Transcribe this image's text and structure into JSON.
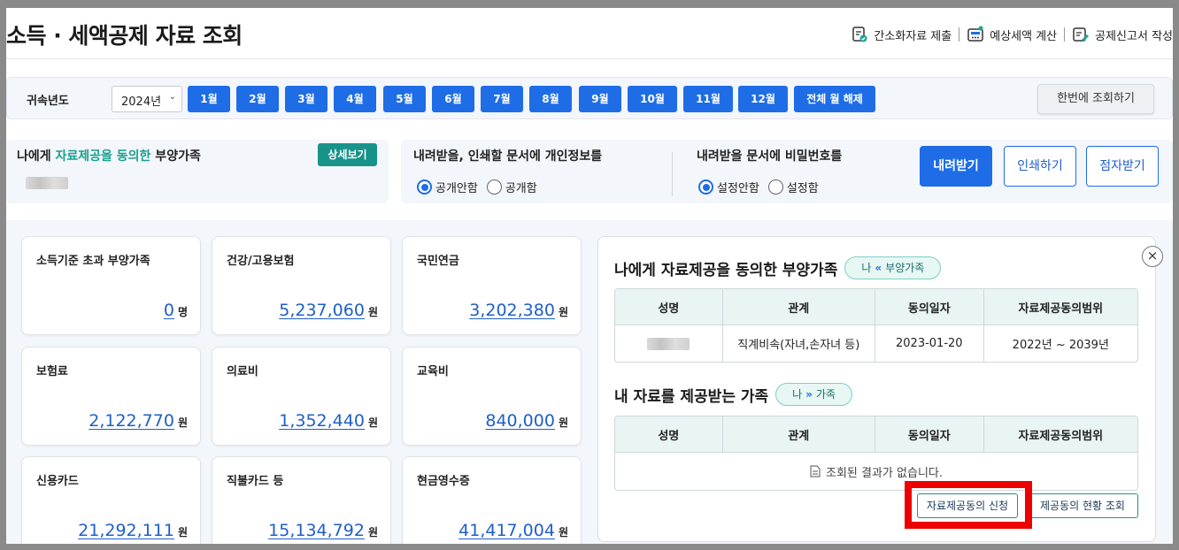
{
  "header": {
    "title": "소득 · 세액공제 자료 조회",
    "links": [
      {
        "label": "간소화자료 제출",
        "icon": "doc-check-icon"
      },
      {
        "label": "예상세액 계산",
        "icon": "calculator-icon"
      },
      {
        "label": "공제신고서 작성",
        "icon": "doc-edit-icon"
      }
    ]
  },
  "year_bar": {
    "label": "귀속년도",
    "year_value": "2024년",
    "months": [
      "1월",
      "2월",
      "3월",
      "4월",
      "5월",
      "6월",
      "7월",
      "8월",
      "9월",
      "10월",
      "11월",
      "12월"
    ],
    "clear_all": "전체 월 해제",
    "query_all": "한번에 조회하기"
  },
  "dependents": {
    "title_pre": "나에게 ",
    "title_hl": "자료제공을 동의한",
    "title_post": " 부양가족",
    "detail_button": "상세보기"
  },
  "options": {
    "personal_info": {
      "title": "내려받을, 인쇄할 문서에 개인정보를",
      "opt1": "공개안함",
      "opt2": "공개함",
      "selected": "공개안함"
    },
    "password": {
      "title": "내려받을 문서에 비밀번호를",
      "opt1": "설정안함",
      "opt2": "설정함",
      "selected": "설정안함"
    },
    "download": "내려받기",
    "print": "인쇄하기",
    "braille": "점자받기"
  },
  "cards": [
    {
      "label": "소득기준 초과 부양가족",
      "value": "0",
      "unit": "명"
    },
    {
      "label": "건강/고용보험",
      "value": "5,237,060",
      "unit": "원"
    },
    {
      "label": "국민연금",
      "value": "3,202,380",
      "unit": "원"
    },
    {
      "label": "보험료",
      "value": "2,122,770",
      "unit": "원"
    },
    {
      "label": "의료비",
      "value": "1,352,440",
      "unit": "원"
    },
    {
      "label": "교육비",
      "value": "840,000",
      "unit": "원"
    },
    {
      "label": "신용카드",
      "value": "21,292,111",
      "unit": "원"
    },
    {
      "label": "직불카드 등",
      "value": "15,134,792",
      "unit": "원"
    },
    {
      "label": "현금영수증",
      "value": "41,417,004",
      "unit": "원"
    }
  ],
  "panel": {
    "close": "×",
    "section1": {
      "title": "나에게 자료제공을 동의한 부양가족",
      "pill_from": "나",
      "pill_arrow": "«",
      "pill_to": "부양가족"
    },
    "columns": [
      "성명",
      "관계",
      "동의일자",
      "자료제공동의범위"
    ],
    "row1": {
      "relation": "직계비속(자녀,손자녀 등)",
      "date": "2023-01-20",
      "range": "2022년 ~ 2039년"
    },
    "section2": {
      "title": "내 자료를 제공받는 가족",
      "pill_from": "나",
      "pill_arrow": "»",
      "pill_to": "가족"
    },
    "empty_text": "조회된 결과가 없습니다.",
    "apply_button": "자료제공동의 신청",
    "status_button": "제공동의 현황 조회"
  },
  "colors": {
    "primary": "#1e6de6",
    "teal": "#17938a",
    "highlight": "#ee0000"
  }
}
